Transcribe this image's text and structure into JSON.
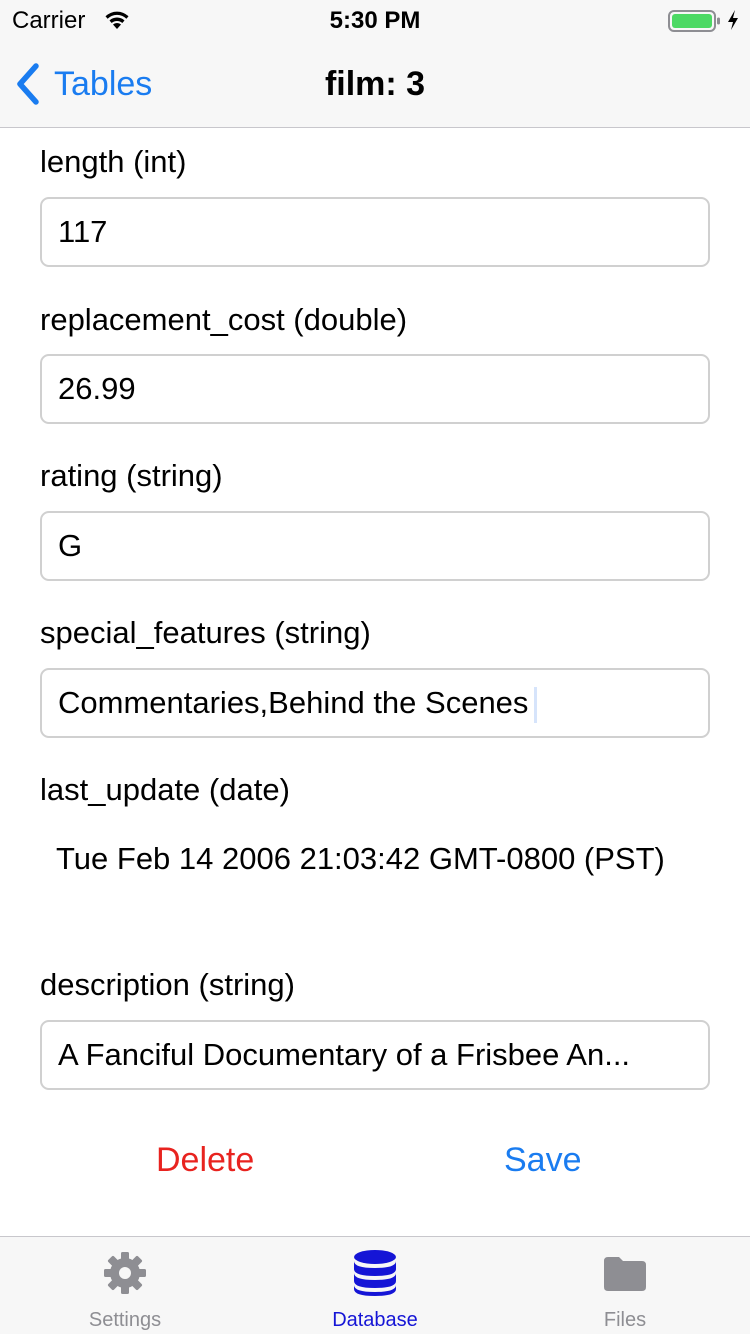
{
  "status_bar": {
    "carrier": "Carrier",
    "time": "5:30 PM",
    "icons": [
      "wifi-icon",
      "battery-icon",
      "charging-bolt-icon"
    ]
  },
  "nav": {
    "back_label": "Tables",
    "title": "film: 3",
    "back_icon": "chevron-left-icon"
  },
  "fields": {
    "length": {
      "label": "length (int)",
      "value": "117"
    },
    "replacement_cost": {
      "label": "replacement_cost (double)",
      "value": "26.99"
    },
    "rating": {
      "label": "rating (string)",
      "value": "G"
    },
    "special_features": {
      "label": "special_features (string)",
      "value": "Commentaries,Behind the Scenes"
    },
    "last_update": {
      "label": "last_update (date)",
      "value": "Tue Feb 14 2006 21:03:42 GMT-0800 (PST)"
    },
    "description": {
      "label": "description (string)",
      "value": "A Fanciful Documentary of a Frisbee An..."
    }
  },
  "actions": {
    "delete_label": "Delete",
    "save_label": "Save"
  },
  "tabs": [
    {
      "label": "Settings",
      "icon": "gear-icon",
      "active": false
    },
    {
      "label": "Database",
      "icon": "database-icon",
      "active": true
    },
    {
      "label": "Files",
      "icon": "folder-icon",
      "active": false
    }
  ],
  "colors": {
    "accent_blue": "#1a7cf0",
    "active_tab": "#1515d6",
    "delete_red": "#e8231f",
    "inactive_tab": "#8e8e93",
    "battery_green": "#4cd964"
  }
}
